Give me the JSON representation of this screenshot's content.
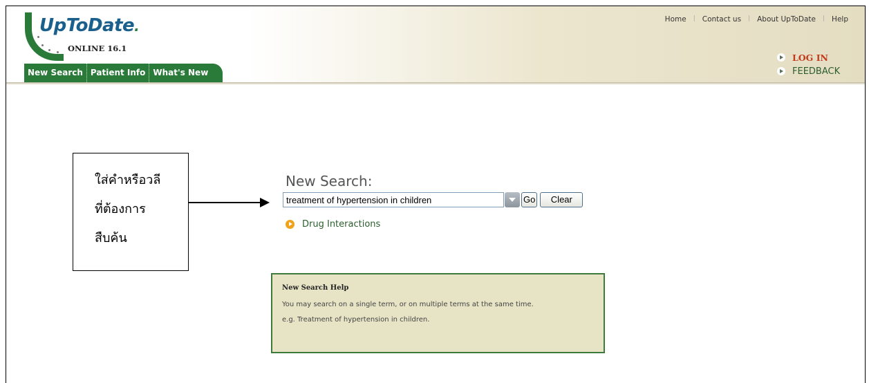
{
  "logo": {
    "brand": "UpToDate",
    "subtitle": "ONLINE 16.1"
  },
  "topnav": {
    "items": [
      "Home",
      "Contact us",
      "About UpToDate",
      "Help"
    ]
  },
  "tabs": [
    "New Search",
    "Patient Info",
    "What's New"
  ],
  "sidelinks": {
    "login": "LOG IN",
    "feedback": "FEEDBACK"
  },
  "callout": {
    "lines": [
      "ใส่คำหรือวลี",
      "ที่ต้องการ",
      "สืบค้น"
    ]
  },
  "search": {
    "title": "New Search:",
    "value": "treatment of hypertension in children",
    "go_label": "Go",
    "clear_label": "Clear"
  },
  "drug_link": {
    "label": "Drug Interactions"
  },
  "help": {
    "title": "New Search Help",
    "body": "You may search on a single term, or on multiple terms at the same time.",
    "example": "e.g. Treatment of hypertension in children."
  },
  "colors": {
    "brand_green": "#2a7b3a",
    "logo_blue": "#1b5f8c",
    "login_red": "#c23a1a",
    "help_bg": "#e7e4c6"
  }
}
